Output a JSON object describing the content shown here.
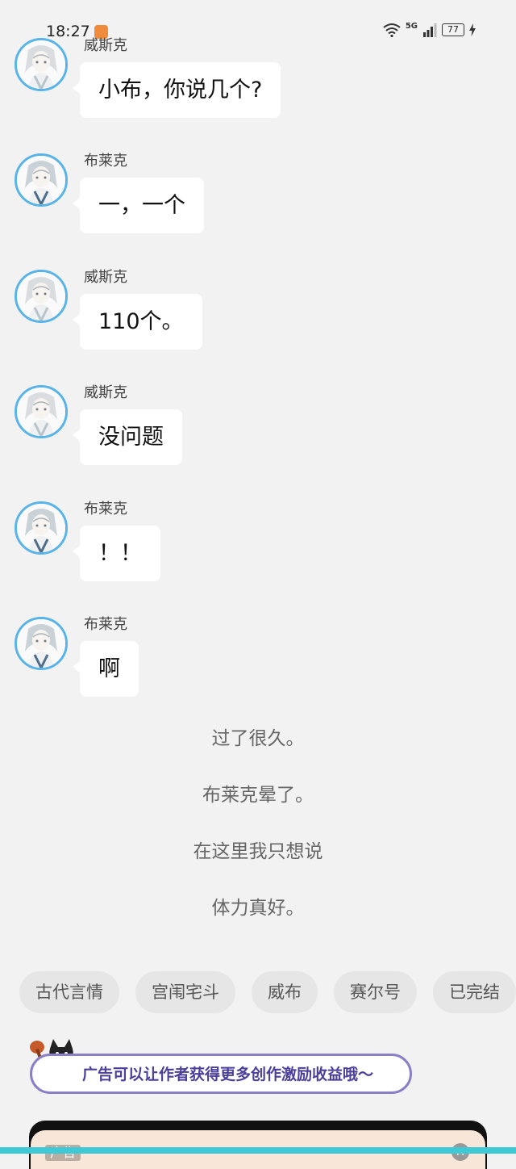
{
  "status_bar": {
    "time": "18:27",
    "network": "5G",
    "battery": "77",
    "icons": [
      "app-notification-icon",
      "wifi-icon",
      "signal-icon",
      "battery-icon",
      "charging-icon"
    ]
  },
  "messages": [
    {
      "speaker": "威斯克",
      "text": "小布，你说几个?",
      "avatar": "avatar-wesker"
    },
    {
      "speaker": "布莱克",
      "text": "一，一个",
      "avatar": "avatar-black"
    },
    {
      "speaker": "威斯克",
      "text": "110个。",
      "avatar": "avatar-wesker"
    },
    {
      "speaker": "威斯克",
      "text": "没问题",
      "avatar": "avatar-wesker"
    },
    {
      "speaker": "布莱克",
      "text": "！！",
      "avatar": "avatar-black"
    },
    {
      "speaker": "布莱克",
      "text": "啊",
      "avatar": "avatar-black"
    }
  ],
  "narration": [
    "过了很久。",
    "布莱克晕了。",
    "在这里我只想说",
    "体力真好。"
  ],
  "tags": [
    "古代言情",
    "宫闱宅斗",
    "威布",
    "赛尔号",
    "已完结"
  ],
  "ad": {
    "banner_text": "广告可以让作者获得更多创作激励收益哦～",
    "label": "广告",
    "close": "✕"
  },
  "colors": {
    "background": "#f2f2f2",
    "avatar_ring": "#58b4e8",
    "ad_border": "#8a7fc6",
    "bottom_strip": "#3fc9d6"
  }
}
